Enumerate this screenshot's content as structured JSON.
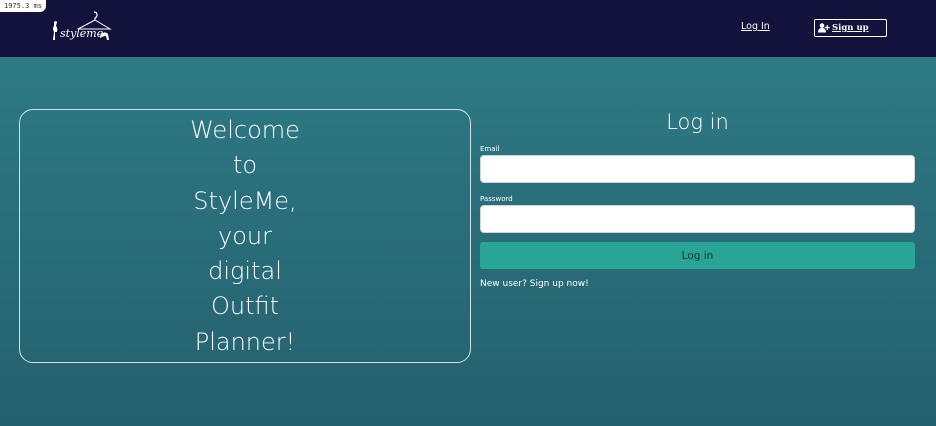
{
  "timer": {
    "text": "1975.3 ms"
  },
  "navbar": {
    "login_label": "Log In",
    "signup_label": "Sign up",
    "logo_text": "StyleMe"
  },
  "welcome": {
    "lines": [
      "Welcome",
      "to",
      "StyleMe,",
      "your",
      "digital",
      "Outfit",
      "Planner!"
    ]
  },
  "login_form": {
    "title": "Log in",
    "email_label": "Email",
    "email_value": "",
    "password_label": "Password",
    "password_value": "",
    "submit_label": "Log in",
    "signup_prompt": "New user? Sign up now!"
  },
  "colors": {
    "navbar_bg": "#13123d",
    "page_bg_top": "#2f7f88",
    "page_bg_bottom": "#25606e",
    "button_bg": "#28a595"
  },
  "icons": [
    "logo-hanger-icon",
    "add-user-icon"
  ]
}
